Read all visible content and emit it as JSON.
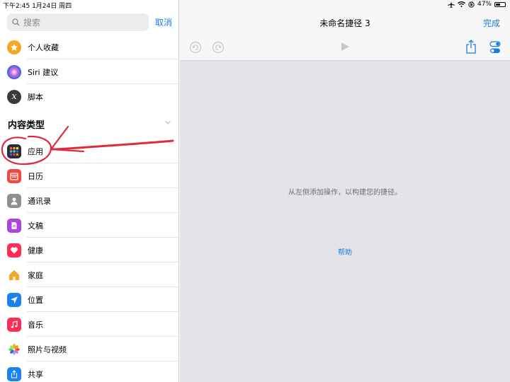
{
  "status_bar": {
    "time_date": "下午2:45   1月24日 周四",
    "battery_percent": "47%",
    "battery_level": 0.47
  },
  "sidebar": {
    "search_placeholder": "搜索",
    "cancel_label": "取消",
    "top_items": [
      {
        "label": "个人收藏",
        "icon": "star-icon",
        "color": "#f5a623"
      },
      {
        "label": "Siri 建议",
        "icon": "siri-icon",
        "color": "#3a3a8c"
      },
      {
        "label": "脚本",
        "icon": "script-x-icon",
        "color": "#3a3a3c"
      }
    ],
    "section_title": "内容类型",
    "content_items": [
      {
        "label": "应用",
        "icon": "apps-grid-icon",
        "color": "#2c2c3a"
      },
      {
        "label": "日历",
        "icon": "calendar-icon",
        "color": "#f04a3e"
      },
      {
        "label": "通讯录",
        "icon": "contacts-icon",
        "color": "#8e8e93"
      },
      {
        "label": "文稿",
        "icon": "document-icon",
        "color": "#b042e0"
      },
      {
        "label": "健康",
        "icon": "heart-icon",
        "color": "#ff2d55"
      },
      {
        "label": "家庭",
        "icon": "home-icon",
        "color": "#f5a623"
      },
      {
        "label": "位置",
        "icon": "location-arrow-icon",
        "color": "#1a82f0"
      },
      {
        "label": "音乐",
        "icon": "music-note-icon",
        "color": "#ff2d55"
      },
      {
        "label": "照片与视频",
        "icon": "photos-flower-icon",
        "color": "#f5a623"
      },
      {
        "label": "共享",
        "icon": "share-icon",
        "color": "#1a82f0"
      }
    ]
  },
  "main": {
    "title": "未命名捷径 3",
    "done_label": "完成",
    "hint_text": "从左侧添加操作，以构建您的捷径。",
    "help_label": "帮助"
  },
  "colors": {
    "accent": "#1c7ae4",
    "annotation": "#e02a3c"
  }
}
